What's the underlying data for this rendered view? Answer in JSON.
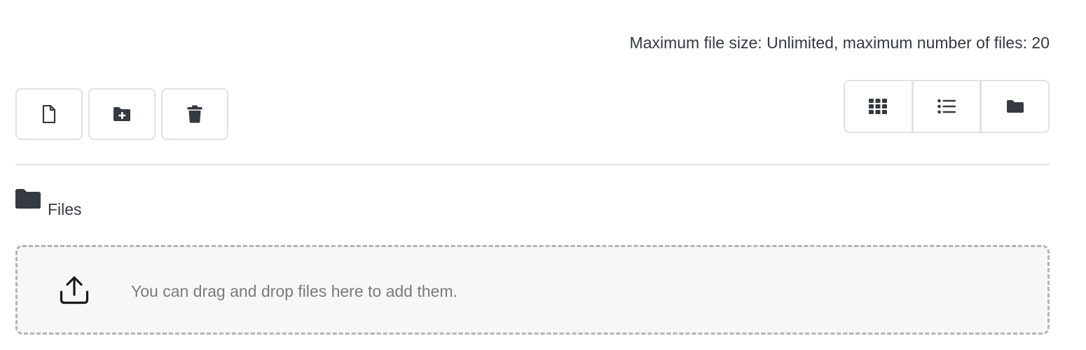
{
  "limits_text": "Maximum file size: Unlimited, maximum number of files: 20",
  "toolbar": {
    "buttons": [
      {
        "icon": "file-icon"
      },
      {
        "icon": "folder-plus-icon"
      },
      {
        "icon": "trash-icon"
      }
    ]
  },
  "view_modes": [
    {
      "icon": "grid-icon"
    },
    {
      "icon": "list-icon"
    },
    {
      "icon": "folder-icon"
    }
  ],
  "path": {
    "icon": "folder-icon",
    "label": "Files"
  },
  "dropzone": {
    "icon": "upload-icon",
    "message": "You can drag and drop files here to add them."
  },
  "colors": {
    "icon": "#343a40",
    "border": "#dee2e6",
    "dropzone_bg": "#f7f7f7",
    "dropzone_text": "#7a7a7a"
  }
}
